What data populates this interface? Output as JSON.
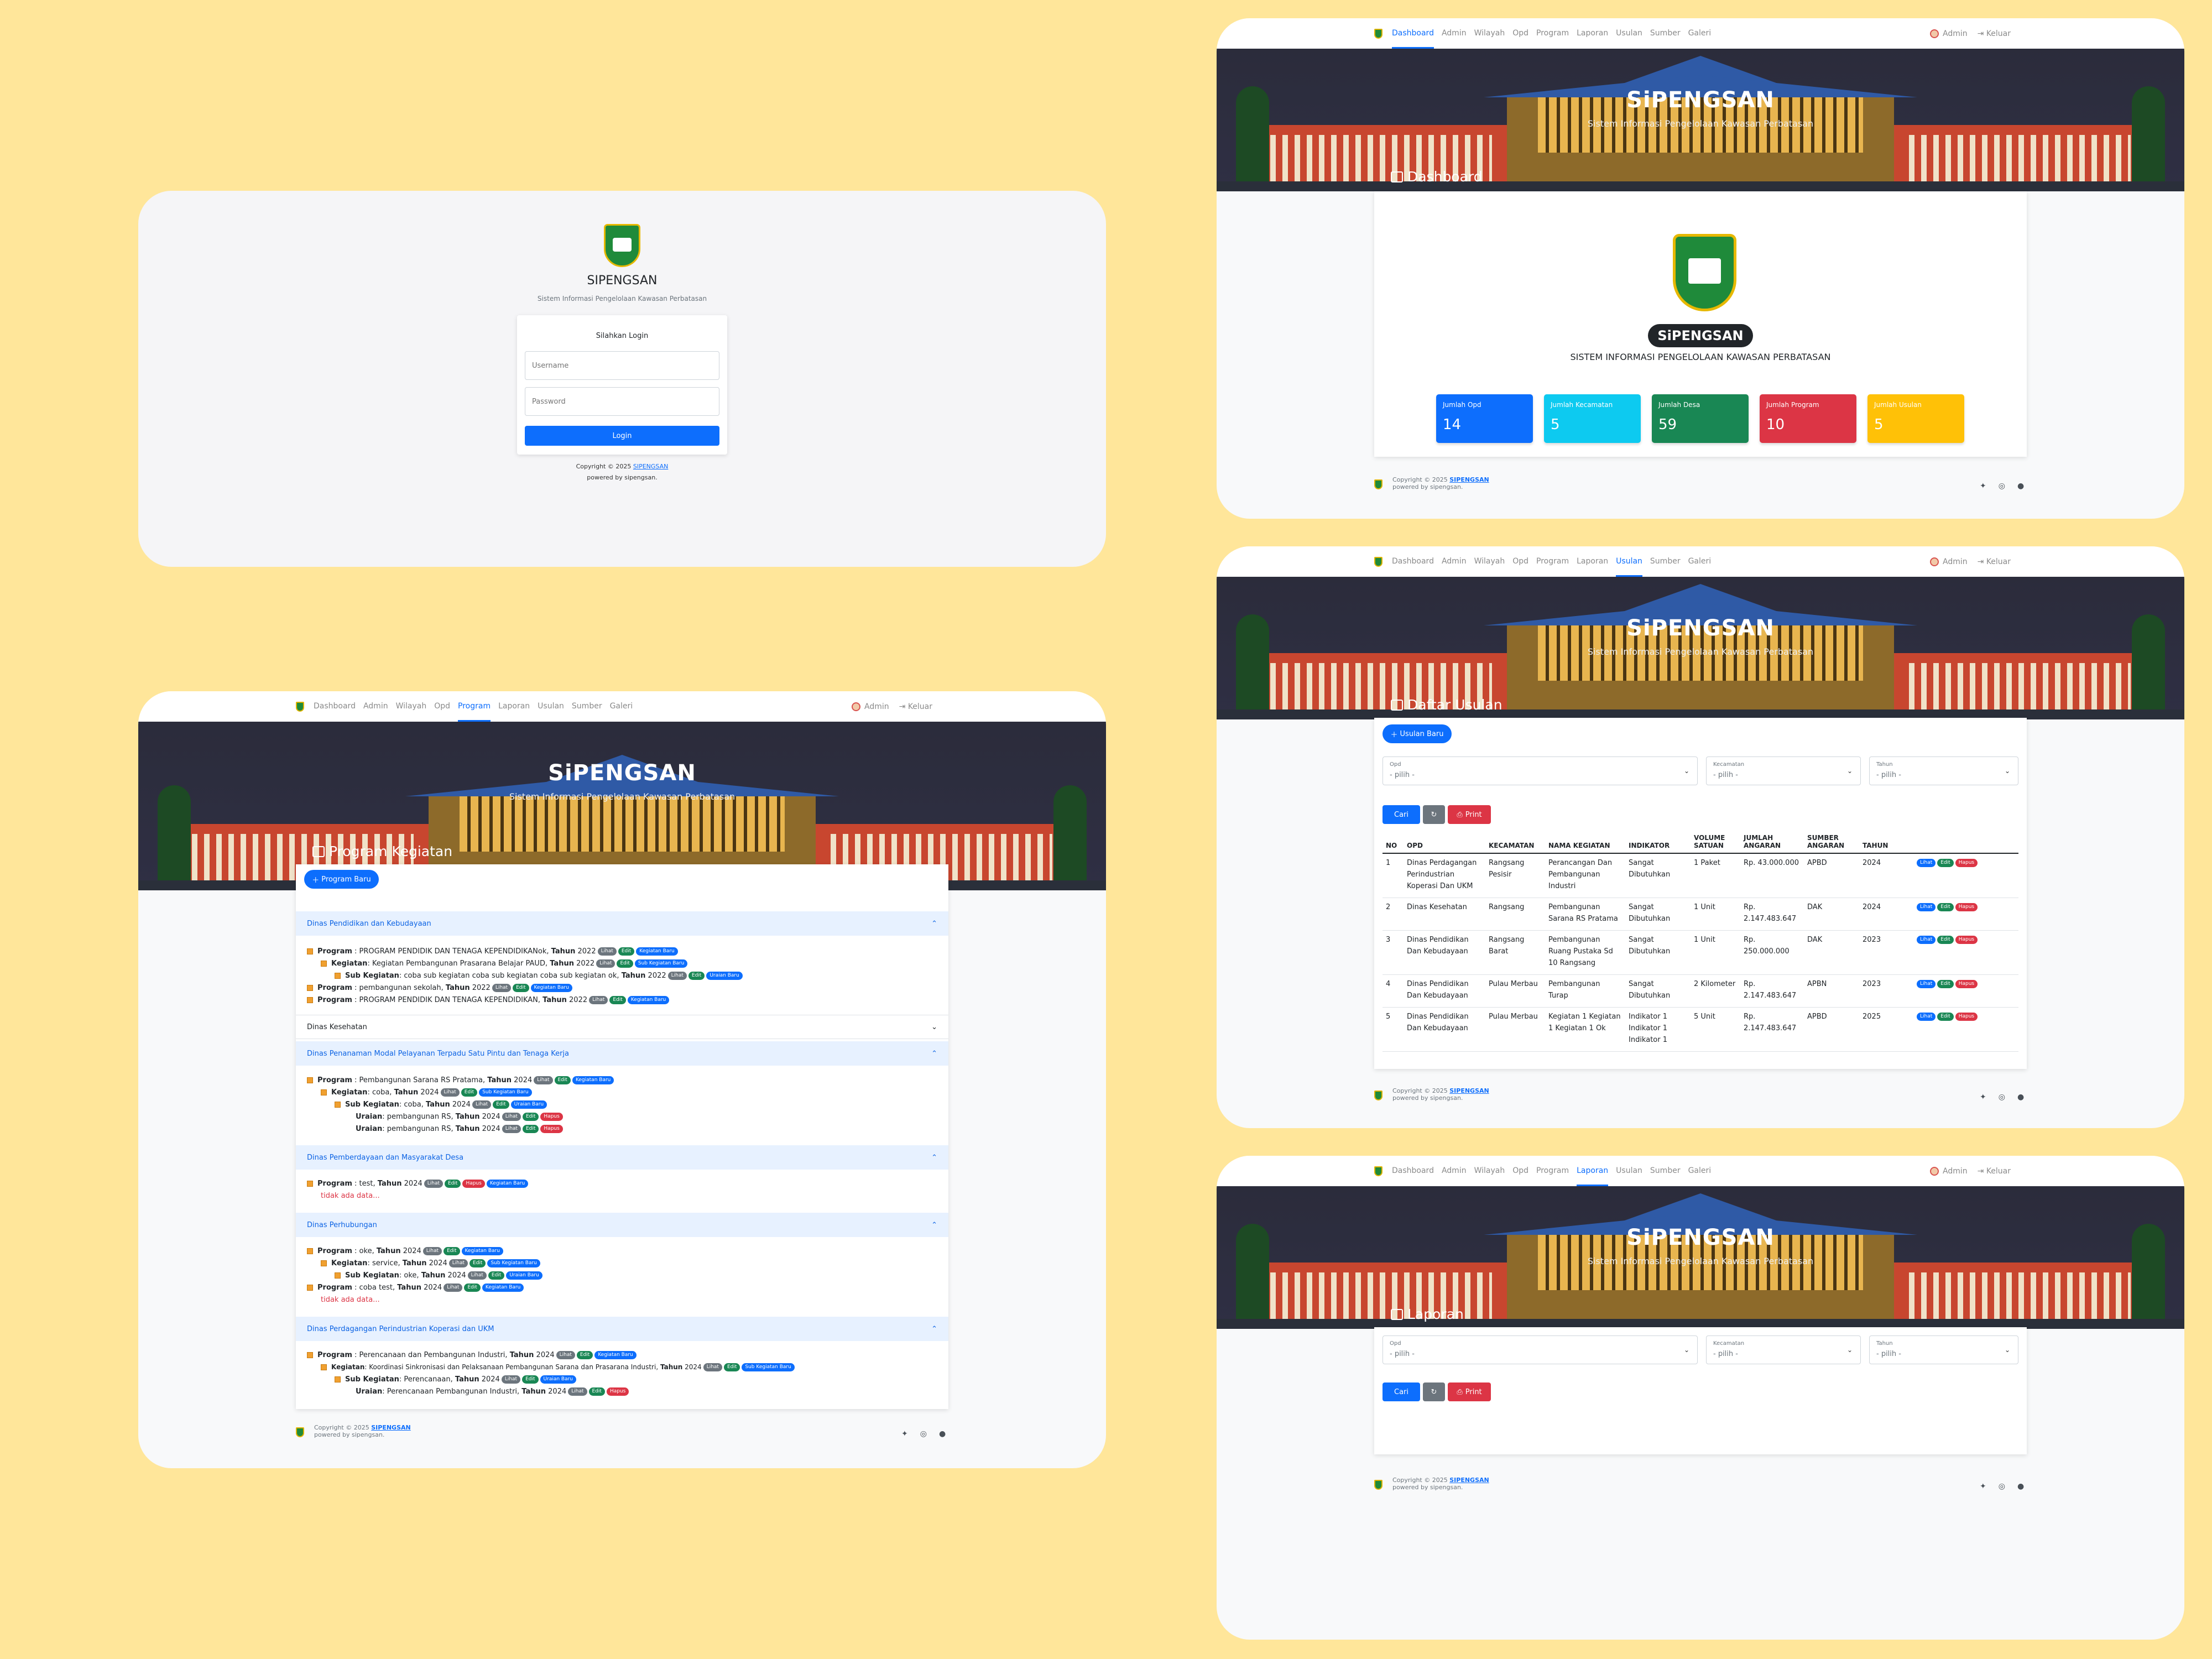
{
  "brand": "SIPENGSAN",
  "nav": {
    "items": [
      "Dashboard",
      "Admin",
      "Wilayah",
      "Opd",
      "Program",
      "Laporan",
      "Usulan",
      "Sumber",
      "Galeri"
    ],
    "user": "Admin",
    "logout": "Keluar"
  },
  "hero": {
    "title": "SiPENGSAN",
    "subtitle": "Sistem Informasi Pengelolaan Kawasan Perbatasan"
  },
  "footer": {
    "copyright": "Copyright © 2025",
    "brand": "SIPENGSAN",
    "powered": "powered by sipengsan."
  },
  "login": {
    "app_name": "SIPENGSAN",
    "app_desc": "Sistem Informasi Pengelolaan Kawasan Perbatasan",
    "heading": "Silahkan Login",
    "username_placeholder": "Username",
    "password_placeholder": "Password",
    "button": "Login",
    "copyright": "Copyright © 2025",
    "brand": "SIPENGSAN",
    "powered": "powered by sipengsan."
  },
  "dashboard": {
    "title": "Dashboard",
    "badge": "SiPENGSAN",
    "app_full": "SISTEM INFORMASI PENGELOLAAN KAWASAN PERBATASAN",
    "stats": [
      {
        "label": "Jumlah Opd",
        "value": "14",
        "color": "#0d6efd"
      },
      {
        "label": "Jumlah Kecamatan",
        "value": "5",
        "color": "#0dcaf0"
      },
      {
        "label": "Jumlah Desa",
        "value": "59",
        "color": "#198754"
      },
      {
        "label": "Jumlah Program",
        "value": "10",
        "color": "#dc3545"
      },
      {
        "label": "Jumlah Usulan",
        "value": "5",
        "color": "#ffc107"
      }
    ]
  },
  "program": {
    "title": "Program Kegiatan",
    "new_button": "Program Baru",
    "pills": {
      "lihat": "Lihat",
      "edit": "Edit",
      "hapus": "Hapus",
      "kegiatan_baru": "Kegiatan Baru",
      "sub_kegiatan_baru": "Sub Kegiatan Baru",
      "uraian_baru": "Uraian Baru"
    },
    "sections": [
      {
        "name": "Dinas Pendidikan dan Kebudayaan",
        "open": true
      },
      {
        "name": "Dinas Kesehatan",
        "open": false
      },
      {
        "name": "Dinas Penanaman Modal Pelayanan Terpadu Satu Pintu dan Tenaga Kerja",
        "open": true
      },
      {
        "name": "Dinas Pemberdayaan dan Masyarakat Desa",
        "open": true
      },
      {
        "name": "Dinas Perhubungan",
        "open": true
      },
      {
        "name": "Dinas Perdagangan Perindustrian Koperasi dan UKM",
        "open": true
      }
    ],
    "no_data": "tidak ada data...",
    "rows": [
      {
        "k": "Program",
        "v": " : PROGRAM PENDIDIK DAN TENAGA KEPENDIDIKANok, ",
        "t": "Tahun",
        "y": " 2022"
      },
      {
        "k": "Kegiatan",
        "v": ": Kegiatan Pembangunan Prasarana Belajar PAUD, ",
        "t": "Tahun",
        "y": " 2022"
      },
      {
        "k": "Sub Kegiatan",
        "v": ": coba sub kegiatan coba sub kegiatan coba sub kegiatan ok, ",
        "t": "Tahun",
        "y": " 2022"
      },
      {
        "k": "Program",
        "v": " : pembangunan sekolah, ",
        "t": "Tahun",
        "y": " 2022"
      },
      {
        "k": "Program",
        "v": " : PROGRAM PENDIDIK DAN TENAGA KEPENDIDIKAN, ",
        "t": "Tahun",
        "y": " 2022"
      },
      {
        "k": "Program",
        "v": " : Pembangunan Sarana RS Pratama, ",
        "t": "Tahun",
        "y": " 2024"
      },
      {
        "k": "Kegiatan",
        "v": ": coba, ",
        "t": "Tahun",
        "y": " 2024"
      },
      {
        "k": "Sub Kegiatan",
        "v": ": coba, ",
        "t": "Tahun",
        "y": " 2024"
      },
      {
        "k": "Uraian",
        "v": ": pembangunan RS, ",
        "t": "Tahun",
        "y": " 2024"
      },
      {
        "k": "Uraian",
        "v": ": pembangunan RS, ",
        "t": "Tahun",
        "y": " 2024"
      },
      {
        "k": "Program",
        "v": " : test, ",
        "t": "Tahun",
        "y": " 2024"
      },
      {
        "k": "Program",
        "v": " : oke, ",
        "t": "Tahun",
        "y": " 2024"
      },
      {
        "k": "Kegiatan",
        "v": ": service, ",
        "t": "Tahun",
        "y": " 2024"
      },
      {
        "k": "Sub Kegiatan",
        "v": ": oke, ",
        "t": "Tahun",
        "y": " 2024"
      },
      {
        "k": "Program",
        "v": " : coba test, ",
        "t": "Tahun",
        "y": " 2024"
      },
      {
        "k": "Program",
        "v": " : Perencanaan dan Pembangunan Industri, ",
        "t": "Tahun",
        "y": " 2024"
      },
      {
        "k": "Kegiatan",
        "v": ": Koordinasi Sinkronisasi dan Pelaksanaan Pembangunan Sarana dan Prasarana Industri, ",
        "t": "Tahun",
        "y": " 2024"
      },
      {
        "k": "Sub Kegiatan",
        "v": ": Perencanaan, ",
        "t": "Tahun",
        "y": " 2024"
      },
      {
        "k": "Uraian",
        "v": ": Perencanaan Pembangunan Industri, ",
        "t": "Tahun",
        "y": " 2024"
      }
    ]
  },
  "usulan": {
    "title": "Daftar Usulan",
    "new_button": "Usulan Baru",
    "filters": {
      "opd": "Opd",
      "kecamatan": "Kecamatan",
      "tahun": "Tahun",
      "placeholder": "- pilih -"
    },
    "buttons": {
      "cari": "Cari",
      "print": "Print"
    },
    "columns": [
      "NO",
      "OPD",
      "KECAMATAN",
      "NAMA KEGIATAN",
      "INDIKATOR",
      "VOLUME SATUAN",
      "JUMLAH ANGARAN",
      "SUMBER ANGARAN",
      "TAHUN"
    ],
    "rows": [
      [
        "1",
        "Dinas Perdagangan Perindustrian Koperasi Dan UKM",
        "Rangsang Pesisir",
        "Perancangan Dan Pembangunan Industri",
        "Sangat Dibutuhkan",
        "1 Paket",
        "Rp. 43.000.000",
        "APBD",
        "2024"
      ],
      [
        "2",
        "Dinas Kesehatan",
        "Rangsang",
        "Pembangunan Sarana RS Pratama",
        "Sangat Dibutuhkan",
        "1 Unit",
        "Rp. 2.147.483.647",
        "DAK",
        "2024"
      ],
      [
        "3",
        "Dinas Pendidikan Dan Kebudayaan",
        "Rangsang Barat",
        "Pembangunan Ruang Pustaka Sd 10 Rangsang",
        "Sangat Dibutuhkan",
        "1 Unit",
        "Rp. 250.000.000",
        "DAK",
        "2023"
      ],
      [
        "4",
        "Dinas Pendidikan Dan Kebudayaan",
        "Pulau Merbau",
        "Pembangunan Turap",
        "Sangat Dibutuhkan",
        "2 Kilometer",
        "Rp. 2.147.483.647",
        "APBN",
        "2023"
      ],
      [
        "5",
        "Dinas Pendidikan Dan Kebudayaan",
        "Pulau Merbau",
        "Kegiatan 1 Kegiatan 1 Kegiatan 1 Ok",
        "Indikator 1 Indikator 1 Indikator 1",
        "5 Unit",
        "Rp. 2.147.483.647",
        "APBD",
        "2025"
      ]
    ],
    "row_actions": {
      "lihat": "Lihat",
      "edit": "Edit",
      "hapus": "Hapus"
    }
  },
  "laporan": {
    "title": "Laporan",
    "filters": {
      "opd": "Opd",
      "kecamatan": "Kecamatan",
      "tahun": "Tahun",
      "placeholder": "- pilih -"
    },
    "buttons": {
      "cari": "Cari",
      "print": "Print"
    }
  }
}
